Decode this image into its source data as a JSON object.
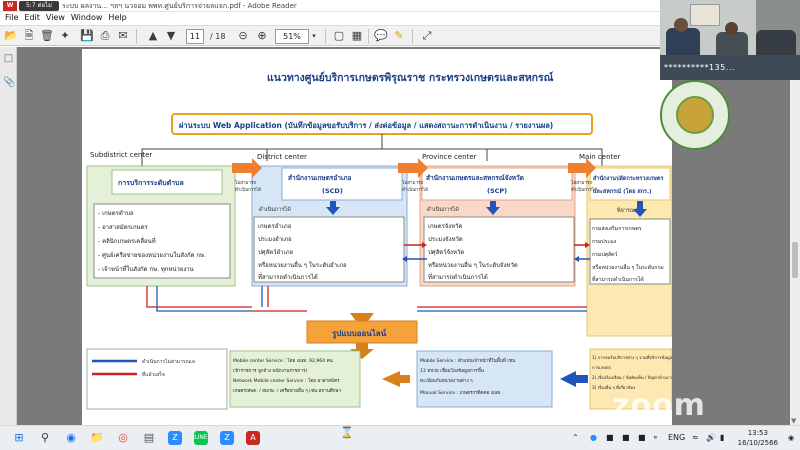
{
  "window": {
    "app_icon_text": "W",
    "recording_badge": "5:7 ต่อไม่",
    "title": "ระบบ ผลงาน... ฯลฯ นวจอม พพท.ศูนย์บริการจ่ายลแจก.pdf - Adobe Reader"
  },
  "menu": [
    "File",
    "Edit",
    "View",
    "Window",
    "Help"
  ],
  "toolbar": {
    "page_current": "11",
    "page_total": "/ 18",
    "zoom": "51%"
  },
  "video": {
    "participant_name": "**********135...",
    "mic_label": "🎙"
  },
  "diagram": {
    "title": "แนวทางศูนย์บริการเกษตรพิรุณราช กระทรวงเกษตรและสหกรณ์",
    "web_app_banner": "ผ่านระบบ Web Application (บันทึกข้อมูลขอรับบริการ / ส่งต่อข้อมูล / แสดงสถานะการดำเนินงาน / รายงานผล)",
    "levels": [
      "Subdistrict center",
      "District center",
      "Province center",
      "Main center"
    ],
    "subdistrict": {
      "head": "การบริการระดับตำบล",
      "items": [
        "- เกษตรตำบล",
        "- อาสาสมัครเกษตร",
        "- คลินิกเกษตรเคลื่อนที่",
        "- ศูนย์เครือข่ายของหน่วยงานในสังกัด กษ.",
        "- เจ้าหน้าที่ในสังกัด กษ. ทุกหน่วยงาน"
      ]
    },
    "district": {
      "head": "สำนักงานเกษตรอำเภอ",
      "code": "(SCD)",
      "sub": "ดำเนินการได้",
      "items": [
        "เกษตรอำเภอ",
        "ประมงอำเภอ",
        "ปศุสัตว์อำเภอ",
        "หรือหน่วยงานอื่น ๆ ในระดับอำเภอ",
        "ที่สามารถดำเนินการได้"
      ]
    },
    "province": {
      "head": "สำนักงานเกษตรและสหกรณ์จังหวัด",
      "code": "(SCP)",
      "sub": "ดำเนินการได้",
      "items": [
        "เกษตรจังหวัด",
        "ประมงจังหวัด",
        "ปศุสัตว์จังหวัด",
        "หรือหน่วยงานอื่น ๆ ในระดับจังหวัด",
        "ที่สามารถดำเนินการได้"
      ]
    },
    "main": {
      "head": "สำนักงานปลัดกระทรวงเกษตร และสหกรณ์ (โดย สกร.)",
      "sub": "พิจารณา",
      "items": [
        "กรมส่งเสริมการเกษตร",
        "กรมประมง",
        "กรมปศุสัตว์",
        "หรือหน่วยงานอื่น ๆ ในระดับกรม",
        "ที่สามารถดำเนินการได้"
      ]
    },
    "handoff_label": "ไม่สามารถ ดำเนินการได้",
    "online_label": "รูปแบบออนไลน์",
    "mobile_box": "Mobile center Service : โดย ฉนท. 92,964 คน (ข้าราชการ ลูกจ้าง พนักงานราชการ) Network Mobile center Service : โดย อาสาสมัคร เกษตร/สพด. / สมกษ. / เครือข่ายอื่น ๆ เช่น สถานศึกษา",
    "mobile_service_box": "Mobile Service : ตัวแทนเจ้าหน้าที่ในพื้นที่ เช่น 13 หน่วย เชื่อมโยงข้อมูลการขึ้นทะเบียนกับหน่วยงานต่าง ๆ Manual Service : เกษตรกรติดต่อ ฉนท.",
    "right_note": "1) การขอรับบริการต่าง ๆ จามที่บริการข้อมูลด้าน การเกษตร 2) เรื่องร้องเรียน / ข้อคิดเห็น / ปัญหาด้านการเกษตร 3) เรื่องอื่น ๆ ที่เกี่ยวข้อง",
    "legend": [
      {
        "label": "ดำเนินการไม่สามารถแล",
        "color": "#2255bb"
      },
      {
        "label": "ที่แล้วเสร็จ",
        "color": "#cc2222"
      }
    ]
  },
  "taskbar": {
    "lang": "ENG",
    "time": "13:53",
    "date": "16/10/2566"
  },
  "watermark": "zoom",
  "colors": {
    "banner_border": "#e8a020",
    "orange": "#f08030",
    "green_panel": "#e4f0d8",
    "blue_panel": "#d6e6f6",
    "salmon_panel": "#f9d8c8",
    "yellow_panel": "#fce8b0"
  }
}
